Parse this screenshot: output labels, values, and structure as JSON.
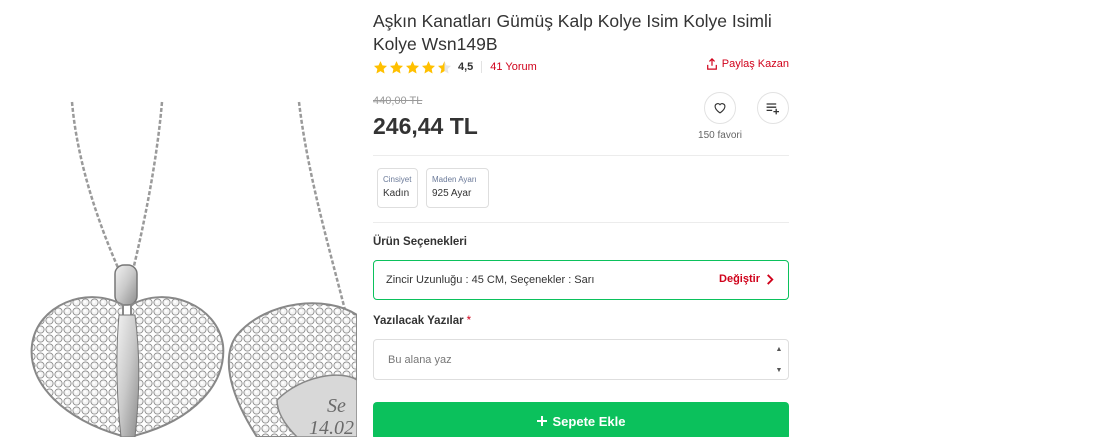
{
  "product": {
    "title": "Aşkın Kanatları Gümüş Kalp Kolye Isim Kolye Isimli Kolye Wsn149B",
    "rating": 4.5,
    "rating_label": "4,5",
    "reviews_label": "41 Yorum",
    "share_label": "Paylaş Kazan",
    "old_price": "440,00 TL",
    "price": "246,44 TL",
    "favorites_label": "150 favori"
  },
  "attributes": [
    {
      "key": "Cinsiyet",
      "value": "Kadın"
    },
    {
      "key": "Maden Ayarı",
      "value": "925 Ayar"
    }
  ],
  "options": {
    "section_title": "Ürün Seçenekleri",
    "variant_text": "Zincir Uzunluğu : 45 CM,  Seçenekler : Sarı",
    "change_label": "Değiştir"
  },
  "engraving": {
    "label": "Yazılacak Yazılar",
    "required_mark": "*",
    "placeholder": "Bu alana yaz"
  },
  "cart": {
    "add_label": "Sepete Ekle"
  },
  "image": {
    "engraving_line1": "Se",
    "engraving_line2": "14.02"
  },
  "colors": {
    "accent_red": "#d0021b",
    "star": "#ffc000",
    "green": "#0bc15c"
  }
}
